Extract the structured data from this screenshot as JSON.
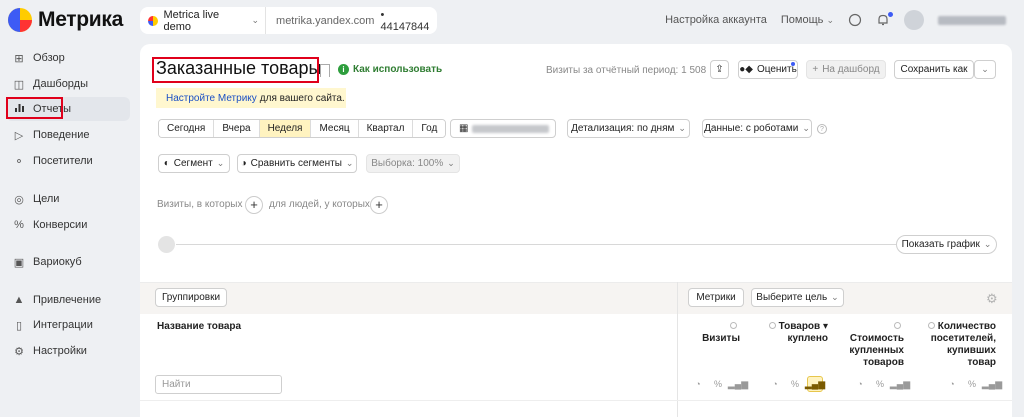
{
  "app": {
    "logo_text": "Метрика"
  },
  "counter": {
    "name": "Metrica live demo",
    "site": "metrika.yandex.com",
    "separator": "•",
    "id": "44147844"
  },
  "topnav": {
    "account_settings": "Настройка аккаунта",
    "help": "Помощь"
  },
  "sidebar": {
    "items": [
      {
        "label": "Обзор",
        "icon": "grid-icon"
      },
      {
        "label": "Дашборды",
        "icon": "dashboard-icon"
      },
      {
        "label": "Отчеты",
        "icon": "bar-chart-icon"
      },
      {
        "label": "Поведение",
        "icon": "play-icon"
      },
      {
        "label": "Посетители",
        "icon": "people-icon"
      },
      {
        "label": "Цели",
        "icon": "target-icon"
      },
      {
        "label": "Конверсии",
        "icon": "percent-icon"
      },
      {
        "label": "Вариокуб",
        "icon": "cube-icon"
      },
      {
        "label": "Привлечение",
        "icon": "flame-icon"
      },
      {
        "label": "Интеграции",
        "icon": "puzzle-icon"
      },
      {
        "label": "Настройки",
        "icon": "gear-icon"
      }
    ],
    "active": "Отчеты"
  },
  "report": {
    "title": "Заказанные товары",
    "how_to_use": "Как использовать",
    "visits_total": "Визиты за отчётный период: 1 508",
    "rate_label": "Оценить",
    "to_dashboard": "На дашборд",
    "save_as": "Сохранить как",
    "notice_link": "Настройте Метрику",
    "notice_text": "для вашего сайта.",
    "periods": [
      "Сегодня",
      "Вчера",
      "Неделя",
      "Месяц",
      "Квартал",
      "Год"
    ],
    "period_selected": "Неделя",
    "detail": "Детализация: по дням",
    "data_mode": "Данные: с роботами",
    "segment": "Сегмент",
    "compare_segments": "Сравнить сегменты",
    "sample": "Выборка: 100%",
    "visits_where": "Визиты, в которых",
    "for_people": "для людей, у которых",
    "show_chart": "Показать график",
    "groupings": "Группировки",
    "metrics": "Метрики",
    "choose_goal": "Выберите цель",
    "col_name": "Название товара",
    "search_placeholder": "Найти",
    "col_visits": "Визиты",
    "col_items_bought_1": "Товаров",
    "col_items_bought_2": "куплено",
    "col_cost_1": "Стоимость",
    "col_cost_2": "купленных",
    "col_cost_3": "товаров",
    "col_buyers_1": "Количество",
    "col_buyers_2": "посетителей,",
    "col_buyers_3": "купивших",
    "col_buyers_4": "товар"
  },
  "colors": {
    "accent": "#3d5bf5",
    "highlight": "#e0001b",
    "selected_bg": "#fff3c0",
    "link": "#1a4fc4",
    "success": "#2e9e3d"
  }
}
